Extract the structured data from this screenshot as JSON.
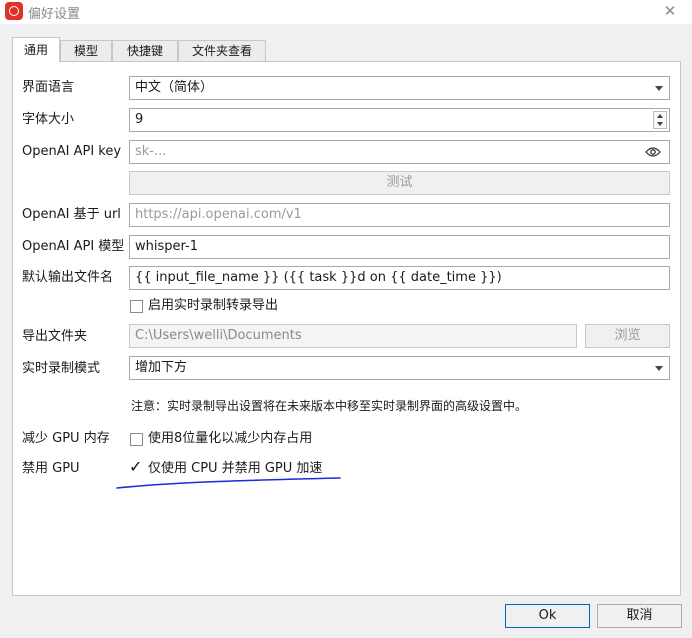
{
  "window": {
    "title": "偏好设置",
    "close_glyph": "✕"
  },
  "tabs": [
    {
      "label": "通用",
      "active": true
    },
    {
      "label": "模型",
      "active": false
    },
    {
      "label": "快捷键",
      "active": false
    },
    {
      "label": "文件夹查看",
      "active": false
    }
  ],
  "general": {
    "language": {
      "label": "界面语言",
      "value": "中文（简体）"
    },
    "font_size": {
      "label": "字体大小",
      "value": "9"
    },
    "api_key": {
      "label": "OpenAI API key",
      "placeholder": "sk-..."
    },
    "test_button": "测试",
    "base_url": {
      "label": "OpenAI 基于 url",
      "placeholder": "https://api.openai.com/v1"
    },
    "model": {
      "label": "OpenAI API 模型",
      "value": "whisper-1"
    },
    "output_filename": {
      "label": "默认输出文件名",
      "value": "{{ input_file_name }} ({{ task }}d on {{ date_time }})"
    },
    "realtime_export": {
      "label": "启用实时录制转录导出",
      "checked": false
    },
    "export_folder": {
      "label": "导出文件夹",
      "value": "C:\\Users\\welli\\Documents",
      "browse": "浏览"
    },
    "realtime_mode": {
      "label": "实时录制模式",
      "value": "增加下方"
    },
    "note": "注意：实时录制导出设置将在未来版本中移至实时录制界面的高级设置中。",
    "reduce_gpu": {
      "label": "减少 GPU 内存",
      "option": "使用8位量化以减少内存占用",
      "checked": false
    },
    "disable_gpu": {
      "label": "禁用 GPU",
      "option": "仅使用 CPU 并禁用 GPU 加速",
      "checked": true
    }
  },
  "footer": {
    "ok": "Ok",
    "cancel": "取消"
  },
  "annotation": {
    "color": "#1f2bd6"
  }
}
